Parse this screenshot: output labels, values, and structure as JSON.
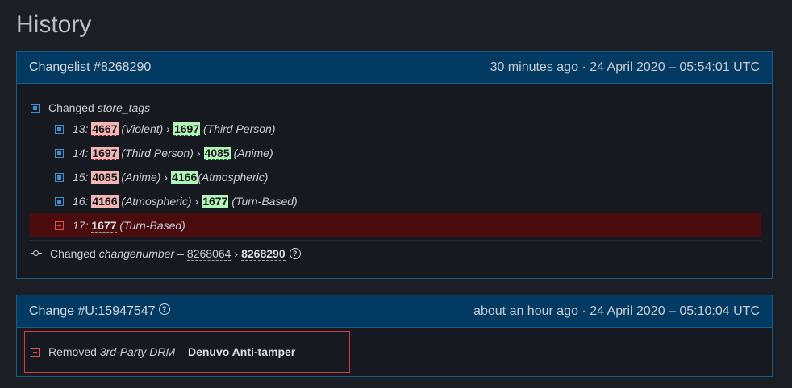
{
  "page": {
    "title": "History"
  },
  "changelist": {
    "title": "Changelist #8268290",
    "time": "30 minutes ago · 24 April 2020 – 05:54:01 UTC",
    "changed_prefix": "Changed",
    "changed_key": "store_tags",
    "rows": [
      {
        "index": "13:",
        "old_id": "4667",
        "old_name": "(Violent)",
        "new_id": "1697",
        "new_name": "(Third Person)"
      },
      {
        "index": "14:",
        "old_id": "1697",
        "old_name": "(Third Person)",
        "new_id": "4085",
        "new_name": "(Anime)"
      },
      {
        "index": "15:",
        "old_id": "4085",
        "old_name": "(Anime)",
        "new_id": "4166",
        "new_name": "(Atmospheric)"
      },
      {
        "index": "16:",
        "old_id": "4166",
        "old_name": "(Atmospheric)",
        "new_id": "1677",
        "new_name": "(Turn-Based)"
      }
    ],
    "removed_row": {
      "index": "17:",
      "id": "1677",
      "name": "(Turn-Based)"
    },
    "changenumber": {
      "prefix": "Changed",
      "key": "changenumber",
      "dash": "–",
      "old": "8268064",
      "new": "8268290"
    }
  },
  "change": {
    "title": "Change #U:15947547",
    "time": "about an hour ago · 24 April 2020 – 05:10:04 UTC",
    "removed_prefix": "Removed",
    "removed_key": "3rd-Party DRM",
    "dash": "–",
    "removed_value": "Denuvo Anti-tamper"
  },
  "glyphs": {
    "arrow": "›",
    "help": "?"
  },
  "colors": {
    "header_bg": "#033a61",
    "panel_border": "#1e5a86",
    "old_highlight": "#f4b5b5",
    "new_highlight": "#b2f5b8",
    "removed_row_bg": "#4a0c0c",
    "changed_icon": "#3d8fd6",
    "removed_icon": "#e05050"
  }
}
